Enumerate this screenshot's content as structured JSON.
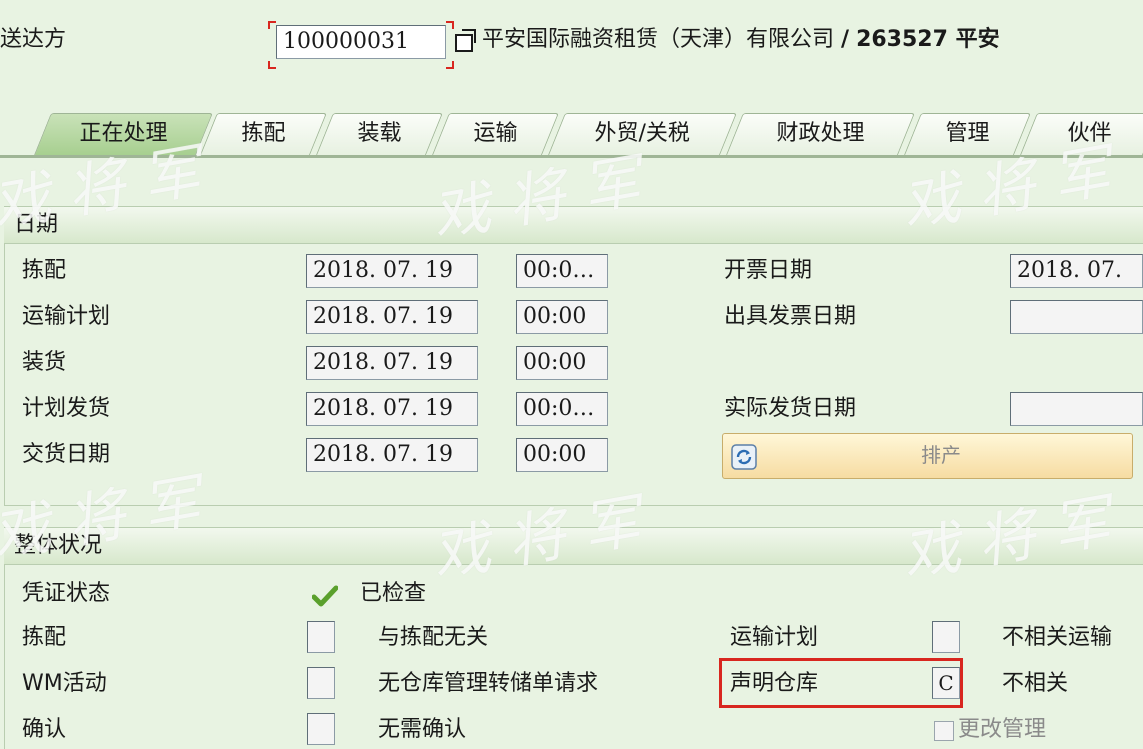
{
  "header": {
    "ship_to_label": "送达方",
    "ship_to_value": "100000031",
    "ship_to_description": "平安国际融资租赁（天津）有限公司",
    "separator": "/",
    "ship_to_extra_prefix": "263527 平安"
  },
  "tabs": [
    {
      "label": "正在处理",
      "active": true
    },
    {
      "label": "拣配",
      "active": false
    },
    {
      "label": "装载",
      "active": false
    },
    {
      "label": "运输",
      "active": false
    },
    {
      "label": "外贸/关税",
      "active": false
    },
    {
      "label": "财政处理",
      "active": false
    },
    {
      "label": "管理",
      "active": false
    },
    {
      "label": "伙伴",
      "active": false
    }
  ],
  "dates": {
    "title": "日期",
    "rows": [
      {
        "label": "拣配",
        "date": "2018. 07. 19",
        "time": "00:0…"
      },
      {
        "label": "运输计划",
        "date": "2018. 07. 19",
        "time": "00:00"
      },
      {
        "label": "装货",
        "date": "2018. 07. 19",
        "time": "00:00"
      },
      {
        "label": "计划发货",
        "date": "2018. 07. 19",
        "time": "00:0…"
      },
      {
        "label": "交货日期",
        "date": "2018. 07. 19",
        "time": "00:00"
      }
    ],
    "billing_date_label": "开票日期",
    "billing_date_value": "2018. 07.",
    "invoice_issue_label": "出具发票日期",
    "invoice_issue_value": "",
    "actual_gi_label": "实际发货日期",
    "actual_gi_value": "",
    "schedule_button_label": "排产"
  },
  "status": {
    "title": "整体状况",
    "doc_status_label": "凭证状态",
    "doc_status_value": "已检查",
    "picking_label": "拣配",
    "picking_value": "",
    "picking_text": "与拣配无关",
    "wm_label": "WM活动",
    "wm_value": "",
    "wm_text": "无仓库管理转储单请求",
    "confirm_label": "确认",
    "confirm_value": "",
    "confirm_text": "无需确认",
    "transport_plan_label": "运输计划",
    "transport_plan_value": "",
    "transport_plan_text": "不相关运输",
    "warehouse_decl_label": "声明仓库",
    "warehouse_decl_value": "C",
    "warehouse_decl_text": "不相关",
    "change_mgmt_label": "更改管理"
  },
  "watermark": {
    "text": "戏将军"
  },
  "colors": {
    "background": "#e8f3e2",
    "highlight_box": "#d8261f",
    "check_green": "#5aa02c"
  }
}
